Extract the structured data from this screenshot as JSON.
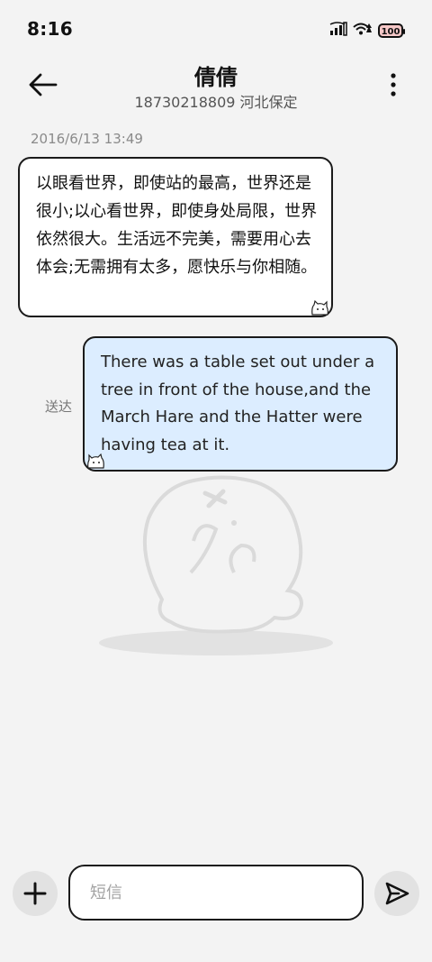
{
  "status_bar": {
    "time": "8:16",
    "battery": "100",
    "icons": [
      "signal-icon",
      "wifi-icon",
      "battery-icon"
    ]
  },
  "header": {
    "contact_name": "倩倩",
    "contact_sub": "18730218809 河北保定"
  },
  "messages": {
    "timestamp": "2016/6/13 13:49",
    "incoming_text": "以眼看世界，即使站的最高，世界还是很小;以心看世界，即使身处局限，世界依然很大。生活远不完美，需要用心去体会;无需拥有太多，愿快乐与你相随。",
    "outgoing_text": "There was a table set out under a tree in front of the house,and the March Hare and the Hatter were having tea at it.",
    "outgoing_status": "送达"
  },
  "composer": {
    "placeholder": "短信"
  },
  "colors": {
    "background": "#f3f3f3",
    "incoming_bubble": "#ffffff",
    "outgoing_bubble": "#dcedff",
    "bubble_border": "#1a1a1a"
  }
}
